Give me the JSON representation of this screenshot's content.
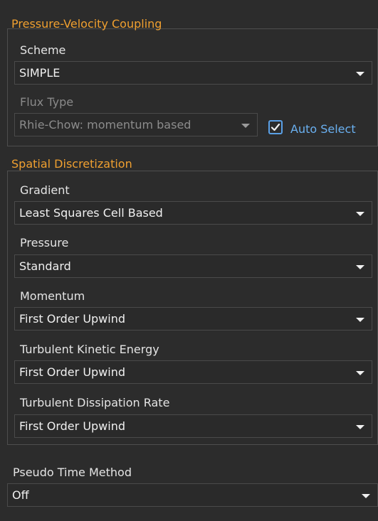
{
  "pressure_velocity": {
    "title": "Pressure-Velocity Coupling",
    "scheme_label": "Scheme",
    "scheme_value": "SIMPLE",
    "flux_type_label": "Flux Type",
    "flux_type_value": "Rhie-Chow: momentum based",
    "auto_select_label": "Auto Select",
    "auto_select_checked": true
  },
  "spatial": {
    "title": "Spatial Discretization",
    "gradient_label": "Gradient",
    "gradient_value": "Least Squares Cell Based",
    "pressure_label": "Pressure",
    "pressure_value": "Standard",
    "momentum_label": "Momentum",
    "momentum_value": "First Order Upwind",
    "tke_label": "Turbulent Kinetic Energy",
    "tke_value": "First Order Upwind",
    "tdr_label": "Turbulent Dissipation Rate",
    "tdr_value": "First Order Upwind"
  },
  "pseudo_time": {
    "label": "Pseudo Time Method",
    "value": "Off"
  },
  "colors": {
    "background": "#2c2c2c",
    "group_title": "#f0a030",
    "accent_blue": "#5aa0e6",
    "text": "#e4e4e4",
    "disabled_text": "#8a8a8a"
  }
}
